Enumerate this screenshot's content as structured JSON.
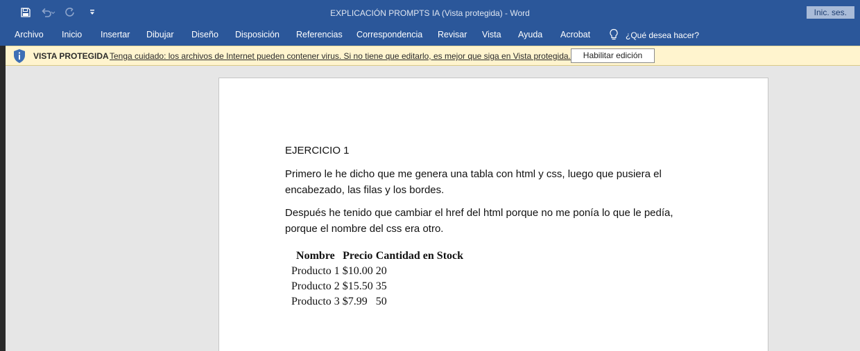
{
  "window": {
    "title": "EXPLICACIÓN PROMPTS IA (Vista protegida)  -  Word",
    "sign_in": "Inic. ses."
  },
  "quick_access": {
    "icons": [
      "save-icon",
      "undo-icon",
      "redo-icon",
      "customize-icon"
    ]
  },
  "ribbon": {
    "tabs": [
      "Archivo",
      "Inicio",
      "Insertar",
      "Dibujar",
      "Diseño",
      "Disposición",
      "Referencias",
      "Correspondencia",
      "Revisar",
      "Vista",
      "Ayuda",
      "Acrobat"
    ],
    "tell_me": "¿Qué desea hacer?"
  },
  "protected_view": {
    "label": "VISTA PROTEGIDA",
    "message": "Tenga cuidado: los archivos de Internet pueden contener virus. Si no tiene que editarlo, es mejor que siga en Vista protegida.",
    "button": "Habilitar edición"
  },
  "document": {
    "heading": "EJERCICIO 1",
    "paragraphs": [
      "Primero le he dicho que me genera una tabla con html y css, luego que pusiera el encabezado, las filas y los bordes.",
      "Después he tenido que cambiar el href del html porque no me ponía lo que le pedía, porque el nombre del css era otro."
    ],
    "table": {
      "headers": [
        "Nombre",
        "Precio",
        "Cantidad en Stock"
      ],
      "rows": [
        [
          "Producto 1",
          "$10.00",
          "20"
        ],
        [
          "Producto 2",
          "$15.50",
          "35"
        ],
        [
          "Producto 3",
          "$7.99",
          "50"
        ]
      ]
    }
  },
  "colors": {
    "titlebar": "#2b579a",
    "infobar": "#fff4ce",
    "canvas": "#e6e6e6"
  }
}
